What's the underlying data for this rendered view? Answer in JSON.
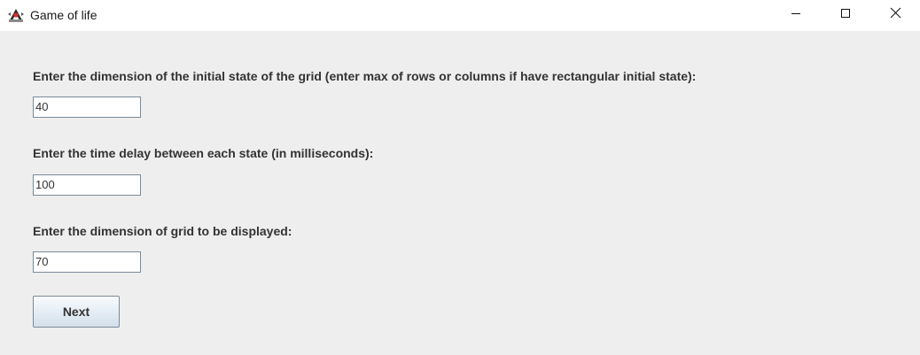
{
  "window": {
    "title": "Game of life",
    "icons": {
      "app": "java-duke-icon",
      "minimize": "minimize-icon",
      "maximize": "maximize-icon",
      "close": "close-icon"
    }
  },
  "form": {
    "rows_prompt": "Enter the dimension of the initial state of the grid (enter max of rows or columns if have rectangular initial state):",
    "rows_value": "40",
    "delay_prompt": "Enter the time delay between each state (in milliseconds):",
    "delay_value": "100",
    "display_prompt": "Enter the dimension of grid to be displayed:",
    "display_value": "70",
    "next_label": "Next"
  },
  "colors": {
    "content_background": "#eeeeee",
    "titlebar_background": "#ffffff",
    "label_text": "#333333",
    "field_border": "#7a8a99"
  }
}
